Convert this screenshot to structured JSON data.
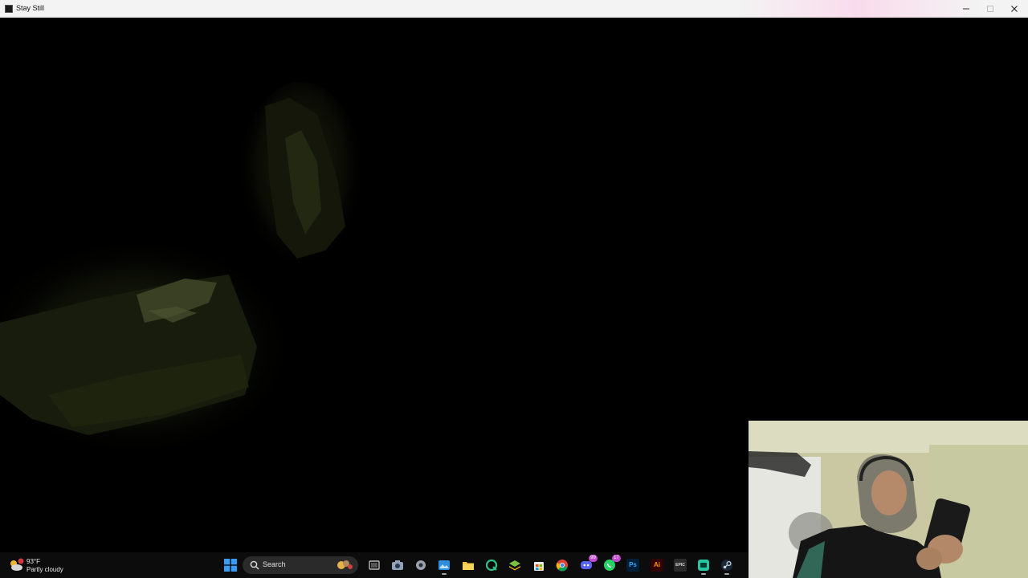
{
  "window": {
    "title": "Stay Still",
    "minimize_icon": "minimize-icon",
    "maximize_icon": "maximize-icon",
    "close_icon": "close-icon"
  },
  "game": {
    "scene": "dark cave"
  },
  "taskbar": {
    "weather": {
      "temperature": "93°F",
      "condition": "Partly cloudy",
      "alert_badge": "1"
    },
    "search": {
      "label": "Search"
    },
    "pinned_icons": [
      "windows-start-icon",
      "task-view-icon",
      "camera-icon",
      "settings-icon",
      "photos-icon",
      "file-explorer-icon",
      "app-q-icon",
      "layers-app-icon",
      "store-icon",
      "chrome-icon",
      "discord-icon",
      "whatsapp-icon",
      "photoshop-icon",
      "illustrator-icon",
      "epic-games-icon",
      "app-green-icon",
      "steam-icon"
    ],
    "badges": {
      "discord": "99",
      "whatsapp": "17"
    },
    "labels": {
      "photoshop": "Ps",
      "illustrator": "Ai",
      "epic": "EPIC"
    },
    "colors": {
      "windows_blue": "#3b9cf5",
      "badge": "#c04ad0"
    }
  }
}
